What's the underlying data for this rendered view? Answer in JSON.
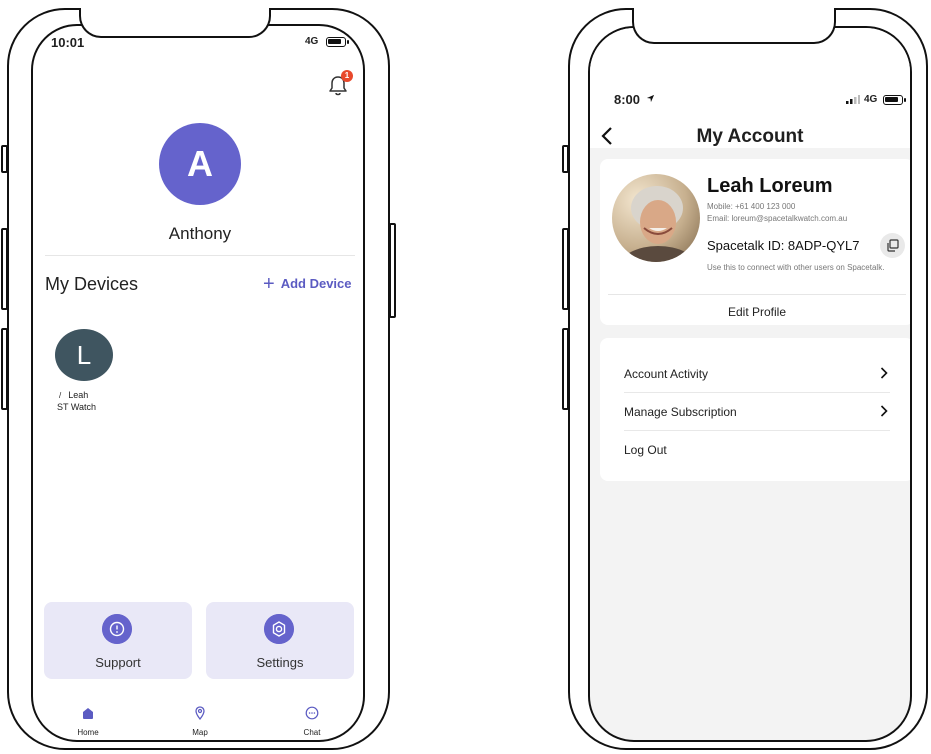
{
  "left_screen": {
    "status": {
      "time": "10:01",
      "network": "4G"
    },
    "notification_count": "1",
    "profile": {
      "initial": "A",
      "name": "Anthony"
    },
    "devices": {
      "title": "My Devices",
      "add_label": "Add Device",
      "items": [
        {
          "initial": "L",
          "name": "Leah",
          "type": "ST Watch"
        }
      ]
    },
    "cards": [
      {
        "label": "Support",
        "icon": "info-icon"
      },
      {
        "label": "Settings",
        "icon": "gear-icon"
      }
    ],
    "tabs": [
      {
        "label": "Home",
        "icon": "home-icon",
        "active": true
      },
      {
        "label": "Map",
        "icon": "map-pin-icon",
        "active": false
      },
      {
        "label": "Chat",
        "icon": "chat-icon",
        "active": false
      }
    ]
  },
  "right_screen": {
    "status": {
      "time": "8:00",
      "network": "4G"
    },
    "nav": {
      "title": "My Account"
    },
    "profile": {
      "name": "Leah Loreum",
      "mobile": "Mobile: +61 400 123 000",
      "email": "Email: loreum@spacetalkwatch.com.au",
      "spacetalk_id": "Spacetalk ID: 8ADP-QYL7",
      "hint": "Use this to connect with other users on Spacetalk.",
      "edit_label": "Edit Profile"
    },
    "menu": [
      {
        "label": "Account Activity",
        "chevron": true
      },
      {
        "label": "Manage Subscription",
        "chevron": true
      },
      {
        "label": "Log Out",
        "chevron": false
      }
    ]
  },
  "colors": {
    "accent": "#6563cc",
    "card_bg": "#e9e8f7",
    "badge": "#e8492c",
    "device_avatar": "#3f5560"
  }
}
